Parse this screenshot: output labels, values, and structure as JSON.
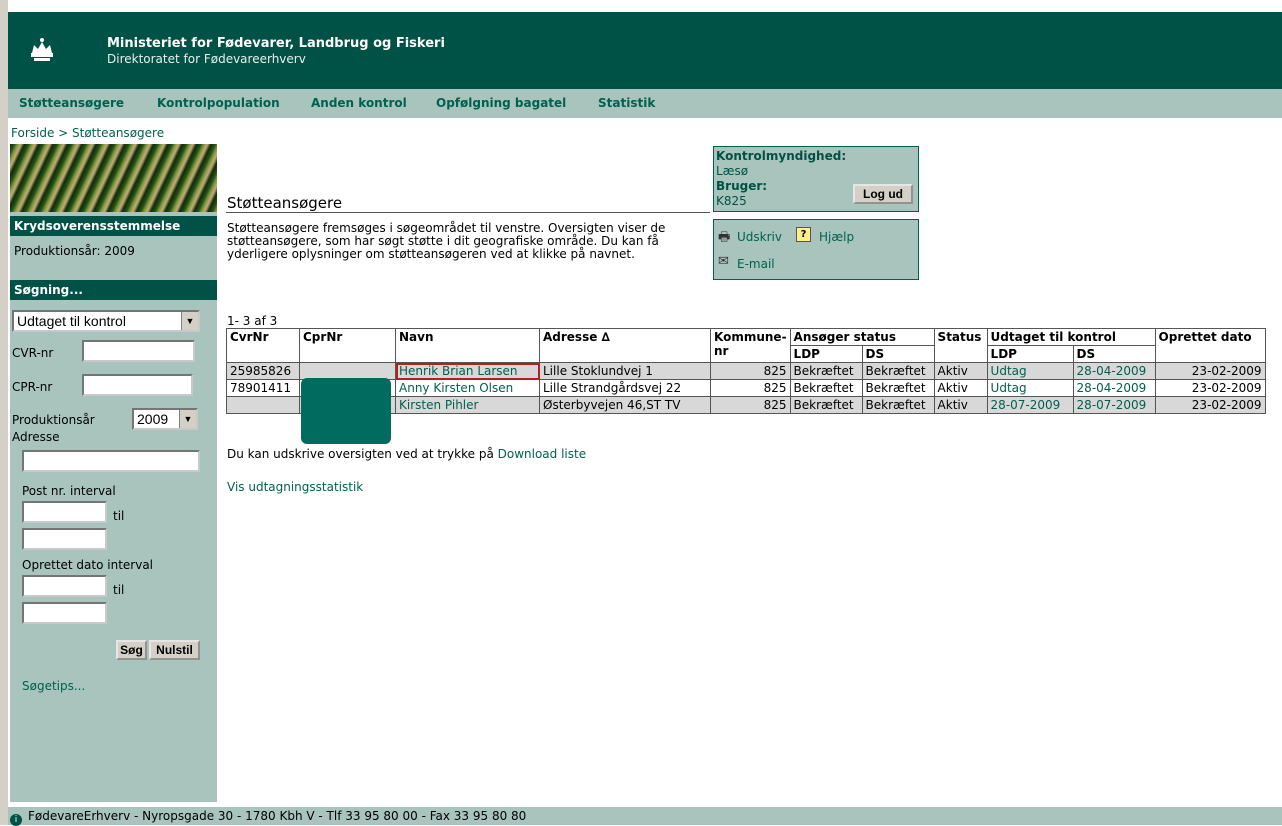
{
  "header": {
    "ministry": "Ministeriet for Fødevarer, Landbrug og Fiskeri",
    "directorate": "Direktoratet for Fødevareerhverv"
  },
  "nav": [
    "Støtteansøgere",
    "Kontrolpopulation",
    "Anden kontrol",
    "Opfølgning bagatel",
    "Statistik"
  ],
  "breadcrumb": "Forside > Støtteansøgere",
  "sidebar": {
    "section1_title": "Krydsoverensstemmelse",
    "production_year_text": "Produktionsår: 2009",
    "section2_title": "Søgning...",
    "filter_select": "Udtaget til kontrol",
    "cvr_label": "CVR-nr",
    "cpr_label": "CPR-nr",
    "year_label": "Produktionsår",
    "year_value": "2009",
    "address_label": "Adresse",
    "postal_label": "Post nr. interval",
    "til": "til",
    "date_label": "Oprettet dato interval",
    "search_button": "Søg",
    "reset_button": "Nulstil",
    "tips_link": "Søgetips..."
  },
  "main": {
    "title": "Støtteansøgere",
    "description": "Støtteansøgere fremsøges i søgeområdet til venstre. Oversigten viser de støtteansøgere, som har søgt støtte i dit geografiske område. Du kan få yderligere oplysninger om støtteansøgeren ved at klikke på navnet.",
    "count": "1- 3 af 3",
    "note_text": "Du kan udskrive oversigten ved at trykke på ",
    "download_link": "Download liste",
    "stats_link": "Vis udtagningsstatistik"
  },
  "infobox": {
    "authority_label": "Kontrolmyndighed:",
    "authority_value": "Læsø",
    "user_label": "Bruger:",
    "user_value": "K825",
    "logout_button": "Log ud"
  },
  "tools": {
    "print": "Udskriv",
    "help": "Hjælp",
    "email": "E-mail"
  },
  "table": {
    "headers": {
      "cvr": "CvrNr",
      "cpr": "CprNr",
      "name": "Navn",
      "address": "Adresse ∆",
      "municipality": "Kommune-nr",
      "applicant_status": "Ansøger status",
      "status": "Status",
      "selected": "Udtaget til kontrol",
      "created": "Oprettet dato",
      "ldp": "LDP",
      "ds": "DS"
    },
    "rows": [
      {
        "cvr": "25985826",
        "cpr": "",
        "name": "Henrik Brian Larsen",
        "address": "Lille Stoklundvej 1",
        "kommune": "825",
        "a_ldp": "Bekræftet",
        "a_ds": "Bekræftet",
        "status": "Aktiv",
        "u_ldp": "Udtag",
        "u_ds": "28-04-2009",
        "created": "23-02-2009"
      },
      {
        "cvr": "78901411",
        "cpr": "",
        "name": "Anny Kirsten Olsen",
        "address": "Lille Strandgårdsvej 22",
        "kommune": "825",
        "a_ldp": "Bekræftet",
        "a_ds": "Bekræftet",
        "status": "Aktiv",
        "u_ldp": "Udtag",
        "u_ds": "28-04-2009",
        "created": "23-02-2009"
      },
      {
        "cvr": "",
        "cpr": "",
        "name": "Kirsten Pihler",
        "address": "Østerbyvejen 46,ST TV",
        "kommune": "825",
        "a_ldp": "Bekræftet",
        "a_ds": "Bekræftet",
        "status": "Aktiv",
        "u_ldp": "28-07-2009",
        "u_ds": "28-07-2009",
        "created": "23-02-2009"
      }
    ]
  },
  "footer": "FødevareErhverv - Nyropsgade 30 - 1780 Kbh V - Tlf 33 95 80 00 - Fax 33 95 80 80",
  "colors": {
    "brand_dark": "#005246",
    "brand_light": "#a8c4bc",
    "link": "#006150"
  }
}
